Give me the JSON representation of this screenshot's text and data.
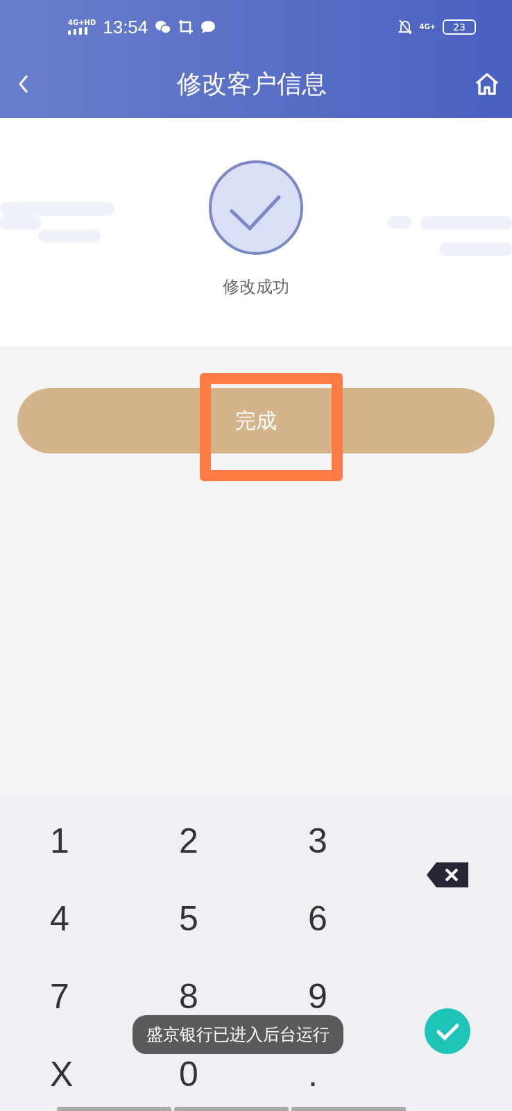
{
  "status_bar": {
    "network": "4G+HD",
    "time": "13:54",
    "network_right": "4G+",
    "battery": "23"
  },
  "header": {
    "title": "修改客户信息"
  },
  "result": {
    "message": "修改成功"
  },
  "done_button": {
    "label": "完成",
    "highlighted": true
  },
  "keypad": {
    "keys": [
      {
        "label": "1",
        "kind": "key"
      },
      {
        "label": "2",
        "kind": "key"
      },
      {
        "label": "3",
        "kind": "key"
      },
      {
        "kind": "backspace"
      },
      {
        "label": "4",
        "kind": "key"
      },
      {
        "label": "5",
        "kind": "key"
      },
      {
        "label": "6",
        "kind": "key"
      },
      {
        "label": "7",
        "kind": "key"
      },
      {
        "label": "8",
        "kind": "key"
      },
      {
        "label": "9",
        "kind": "key"
      },
      {
        "kind": "confirm"
      },
      {
        "label": "X",
        "kind": "key"
      },
      {
        "label": "0",
        "kind": "key"
      },
      {
        "label": ".",
        "kind": "key"
      }
    ]
  },
  "toast": "盛京银行已进入后台运行"
}
